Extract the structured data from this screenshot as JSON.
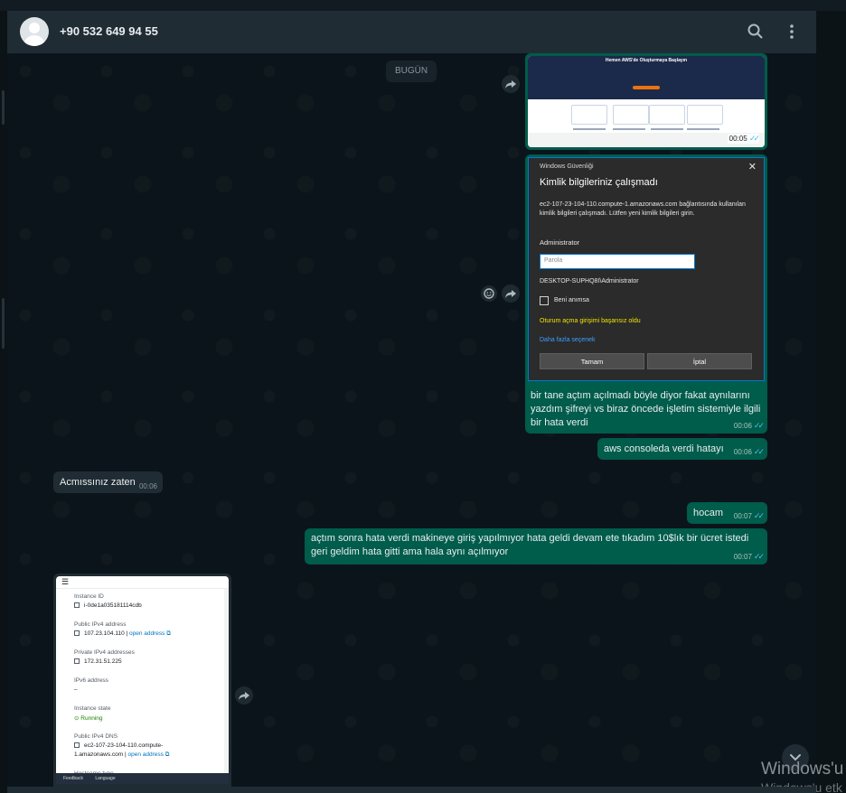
{
  "header": {
    "contact_name": "+90 532 649 94 55",
    "search_icon": "search-icon",
    "menu_icon": "kebab-menu-icon"
  },
  "chat": {
    "date_chip": "BUGÜN",
    "messages": [
      {
        "type": "image",
        "direction": "out",
        "description_icon": "aws-landing-screenshot",
        "banner_title": "Hemen AWS'de Oluşturmaya Başlayın",
        "time": "00:05",
        "status": "read"
      },
      {
        "type": "image",
        "direction": "out",
        "dialog": {
          "window_title": "Windows Güvenliği",
          "heading": "Kimlik bilgileriniz çalışmadı",
          "description": "ec2-107-23-104-110.compute-1.amazonaws.com bağlantısında kullanılan kimlik bilgileri çalışmadı. Lütfen yeni kimlik bilgileri girin.",
          "username": "Administrator",
          "password_placeholder": "Parola",
          "domain": "DESKTOP-SUPHQ8I\\Administrator",
          "remember_label": "Beni anımsa",
          "error_text": "Oturum açma girişimi başarısız oldu",
          "more_options": "Daha fazla seçenek",
          "ok_label": "Tamam",
          "cancel_label": "İptal"
        },
        "caption": "bir tane açtım açılmadı böyle diyor fakat aynılarını yazdım şifreyi vs biraz öncede işletim sistemiyle ilgili bir hata verdi",
        "time": "00:06",
        "status": "read"
      },
      {
        "type": "text",
        "direction": "out",
        "text": "aws consoleda verdi hatayı",
        "time": "00:06",
        "status": "read"
      },
      {
        "type": "text",
        "direction": "in",
        "text": "Acmıssınız zaten",
        "time": "00:06"
      },
      {
        "type": "text",
        "direction": "out",
        "text": "hocam",
        "time": "00:07",
        "status": "read"
      },
      {
        "type": "text",
        "direction": "out",
        "text": "açtım sonra hata verdi makineye giriş yapılmıyor hata geldi devam ete tıkadım 10$lık bir ücret istedi geri geldim hata gitti ama hala aynı açılmıyor",
        "time": "00:07",
        "status": "read"
      },
      {
        "type": "image",
        "direction": "in",
        "panel": {
          "instance_id_label": "Instance ID",
          "instance_id": "i-0de1a035181114cdb",
          "public_ip_label": "Public IPv4 address",
          "public_ip": "107.23.104.110",
          "open_address": "open address",
          "private_ip_label": "Private IPv4 addresses",
          "private_ip": "172.31.51.225",
          "ipv6_label": "IPv6 address",
          "ipv6": "–",
          "state_label": "Instance state",
          "state": "Running",
          "dns_label": "Public IPv4 DNS",
          "dns_line1": "ec2-107-23-104-110.compute-",
          "dns_line2": "1.amazonaws.com",
          "hostname_label": "Hostname type",
          "footer_feedback": "Feedback",
          "footer_language": "Language"
        }
      }
    ]
  },
  "overlay": {
    "activate_line1": "Windows'u",
    "activate_line2": "Windows'u etk"
  },
  "colors": {
    "background": "#0b141a",
    "header": "#202c33",
    "outgoing_bubble": "#005c4b",
    "incoming_bubble": "#202c33",
    "read_ticks": "#53bdeb"
  }
}
